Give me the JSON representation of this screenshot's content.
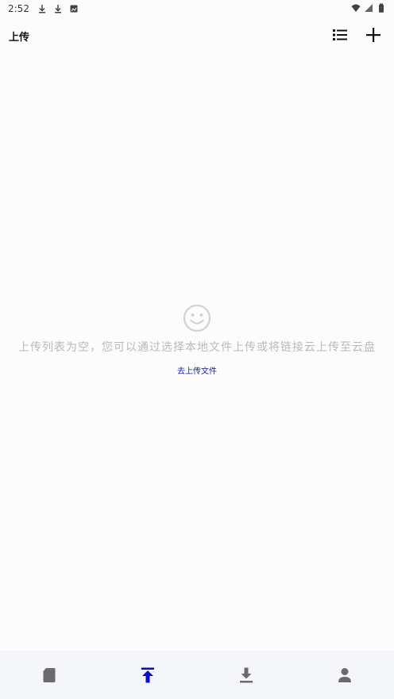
{
  "status_bar": {
    "time": "2:52",
    "left_icons": [
      "download-icon",
      "download-icon",
      "image-notification-icon"
    ],
    "right_icons": [
      "wifi-icon",
      "signal-icon",
      "battery-icon"
    ]
  },
  "header": {
    "title": "上传",
    "actions": [
      "list-icon",
      "add-icon"
    ]
  },
  "empty_state": {
    "icon": "smiley-icon",
    "message": "上传列表为空，您可以通过选择本地文件上传或将链接云上传至云盘",
    "link": "去上传文件"
  },
  "bottom_nav": {
    "items": [
      {
        "icon": "cloud-drive-icon",
        "active": false
      },
      {
        "icon": "upload-icon",
        "active": true
      },
      {
        "icon": "download-icon",
        "active": false
      },
      {
        "icon": "profile-icon",
        "active": false
      }
    ],
    "active_color": "#0a0ad6",
    "inactive_color": "#6a6a70"
  }
}
